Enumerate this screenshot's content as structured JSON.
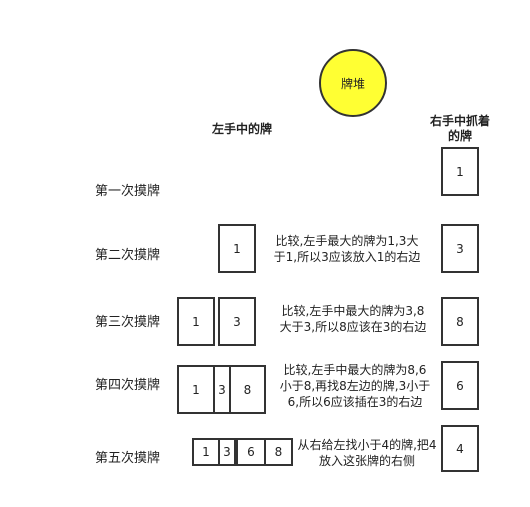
{
  "pile": {
    "label": "牌堆"
  },
  "headings": {
    "left_hand": "左手中的牌",
    "right_hand_line1": "右手中抓着",
    "right_hand_line2": "的牌"
  },
  "steps": [
    {
      "label": "第一次摸牌",
      "left_cards": [],
      "right_card": "1",
      "note": []
    },
    {
      "label": "第二次摸牌",
      "left_cards": [
        "1"
      ],
      "right_card": "3",
      "note": [
        "比较,左手最大的牌为1,3大",
        "于1,所以3应该放入1的右边"
      ]
    },
    {
      "label": "第三次摸牌",
      "left_cards": [
        "1",
        "3"
      ],
      "right_card": "8",
      "note": [
        "比较,左手中最大的牌为3,8",
        "大于3,所以8应该在3的右边"
      ]
    },
    {
      "label": "第四次摸牌",
      "left_cards": [
        "1",
        "3",
        "8"
      ],
      "right_card": "6",
      "note": [
        "比较,左手中最大的牌为8,6",
        "小于8,再找8左边的牌,3小于",
        "6,所以6应该插在3的右边"
      ]
    },
    {
      "label": "第五次摸牌",
      "left_cards": [
        "1",
        "3",
        "6",
        "8"
      ],
      "right_card": "4",
      "note": [
        "从右给左找小于4的牌,把4",
        "放入这张牌的右侧"
      ]
    }
  ]
}
